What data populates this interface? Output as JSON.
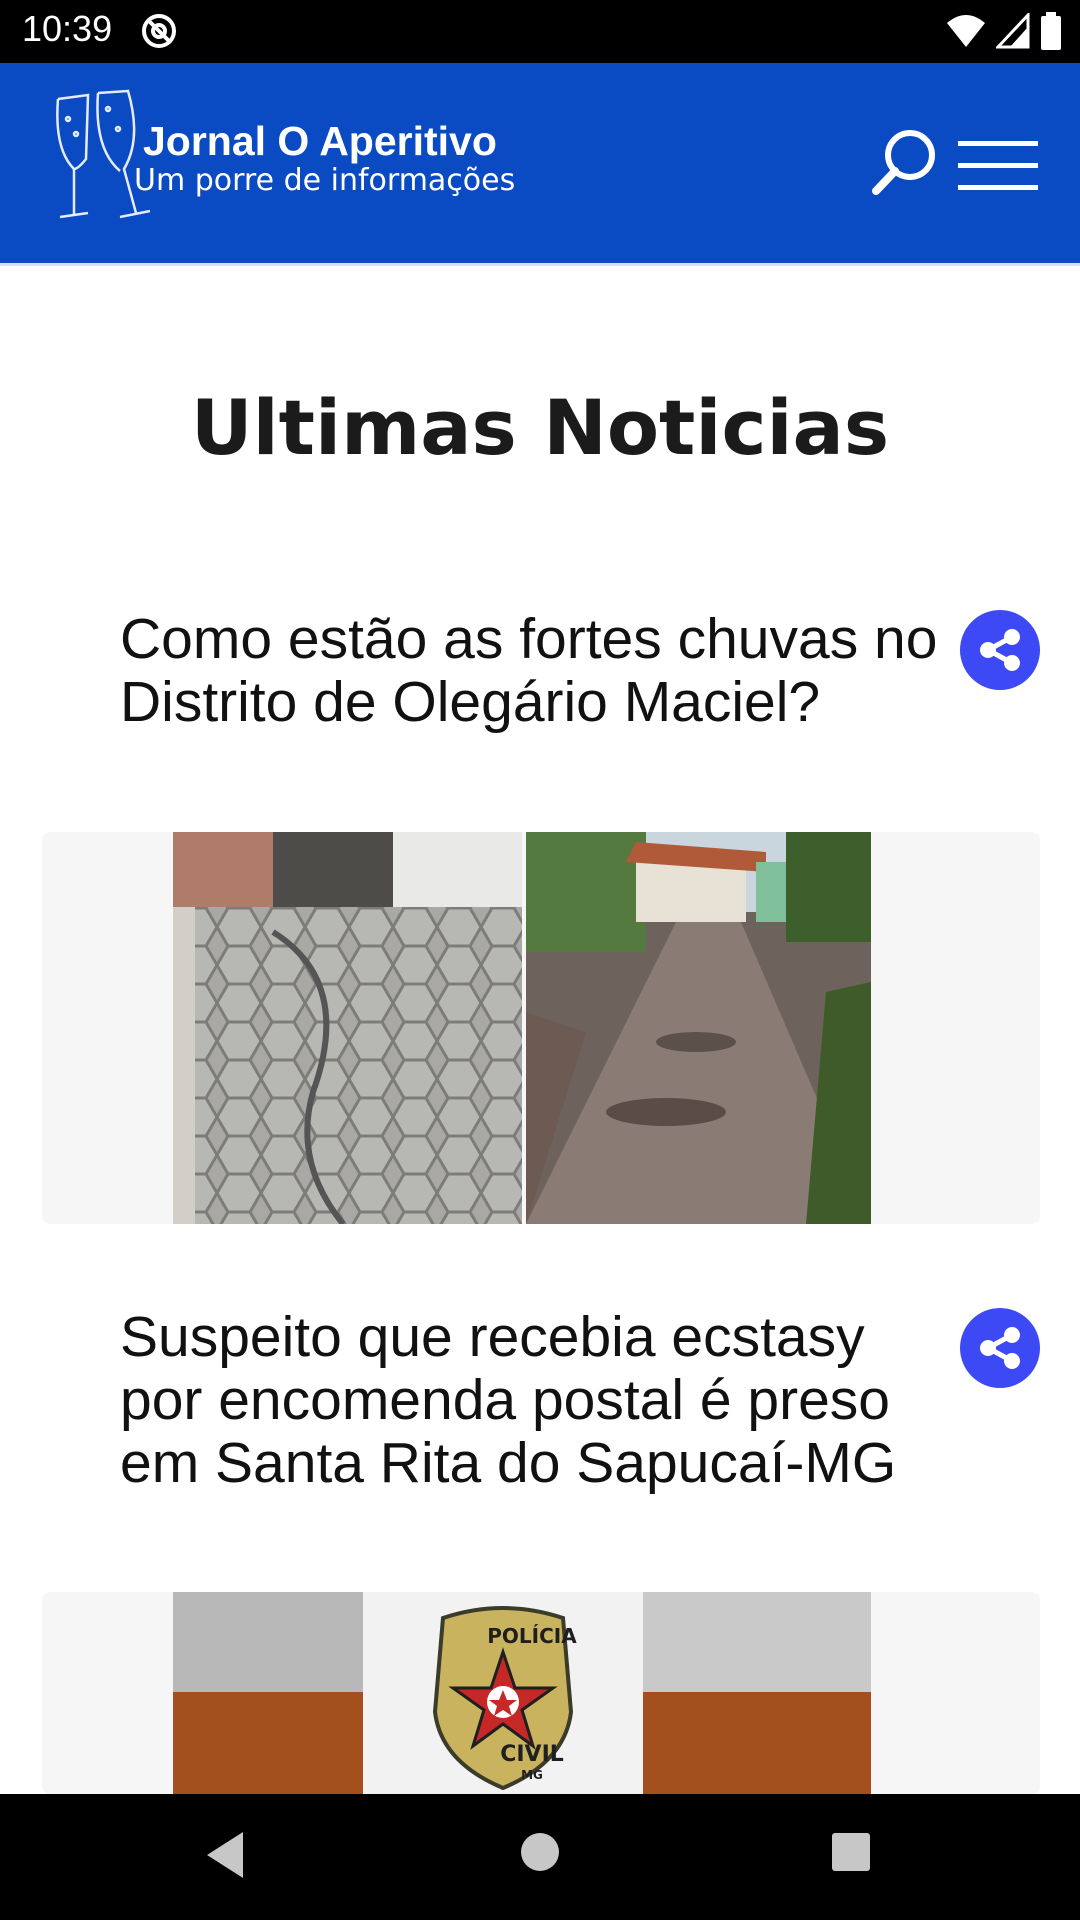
{
  "status_bar": {
    "time": "10:39",
    "icons": [
      "at-sign-icon",
      "wifi-icon",
      "cellular-signal-icon",
      "battery-icon"
    ]
  },
  "header": {
    "brand_title": "Jornal O Aperitivo",
    "brand_tagline": "Um porre de informações",
    "background_color": "#0a4bc4",
    "logo_icon": "champagne-glasses-icon",
    "search_icon": "search-icon",
    "menu_icon": "hamburger-menu-icon"
  },
  "main": {
    "page_title": "Ultimas Noticias",
    "articles": [
      {
        "title": "Como estão as fortes chuvas no Distrito de Olegário Maciel?",
        "share_icon": "share-icon",
        "images": [
          "broken-hexagon-paving-photo",
          "wet-street-village-photo"
        ]
      },
      {
        "title": "Suspeito que recebia ecstasy por encomenda postal é preso em Santa Rita do Sapucaí-MG",
        "share_icon": "share-icon",
        "badge_top": "POLÍCIA",
        "badge_bottom": "CIVIL",
        "badge_state": "MG"
      }
    ]
  },
  "colors": {
    "share_button": "#3d49f4",
    "title_text": "#111111"
  },
  "nav_bar": {
    "icons": [
      "back-icon",
      "home-icon",
      "recents-icon"
    ]
  }
}
